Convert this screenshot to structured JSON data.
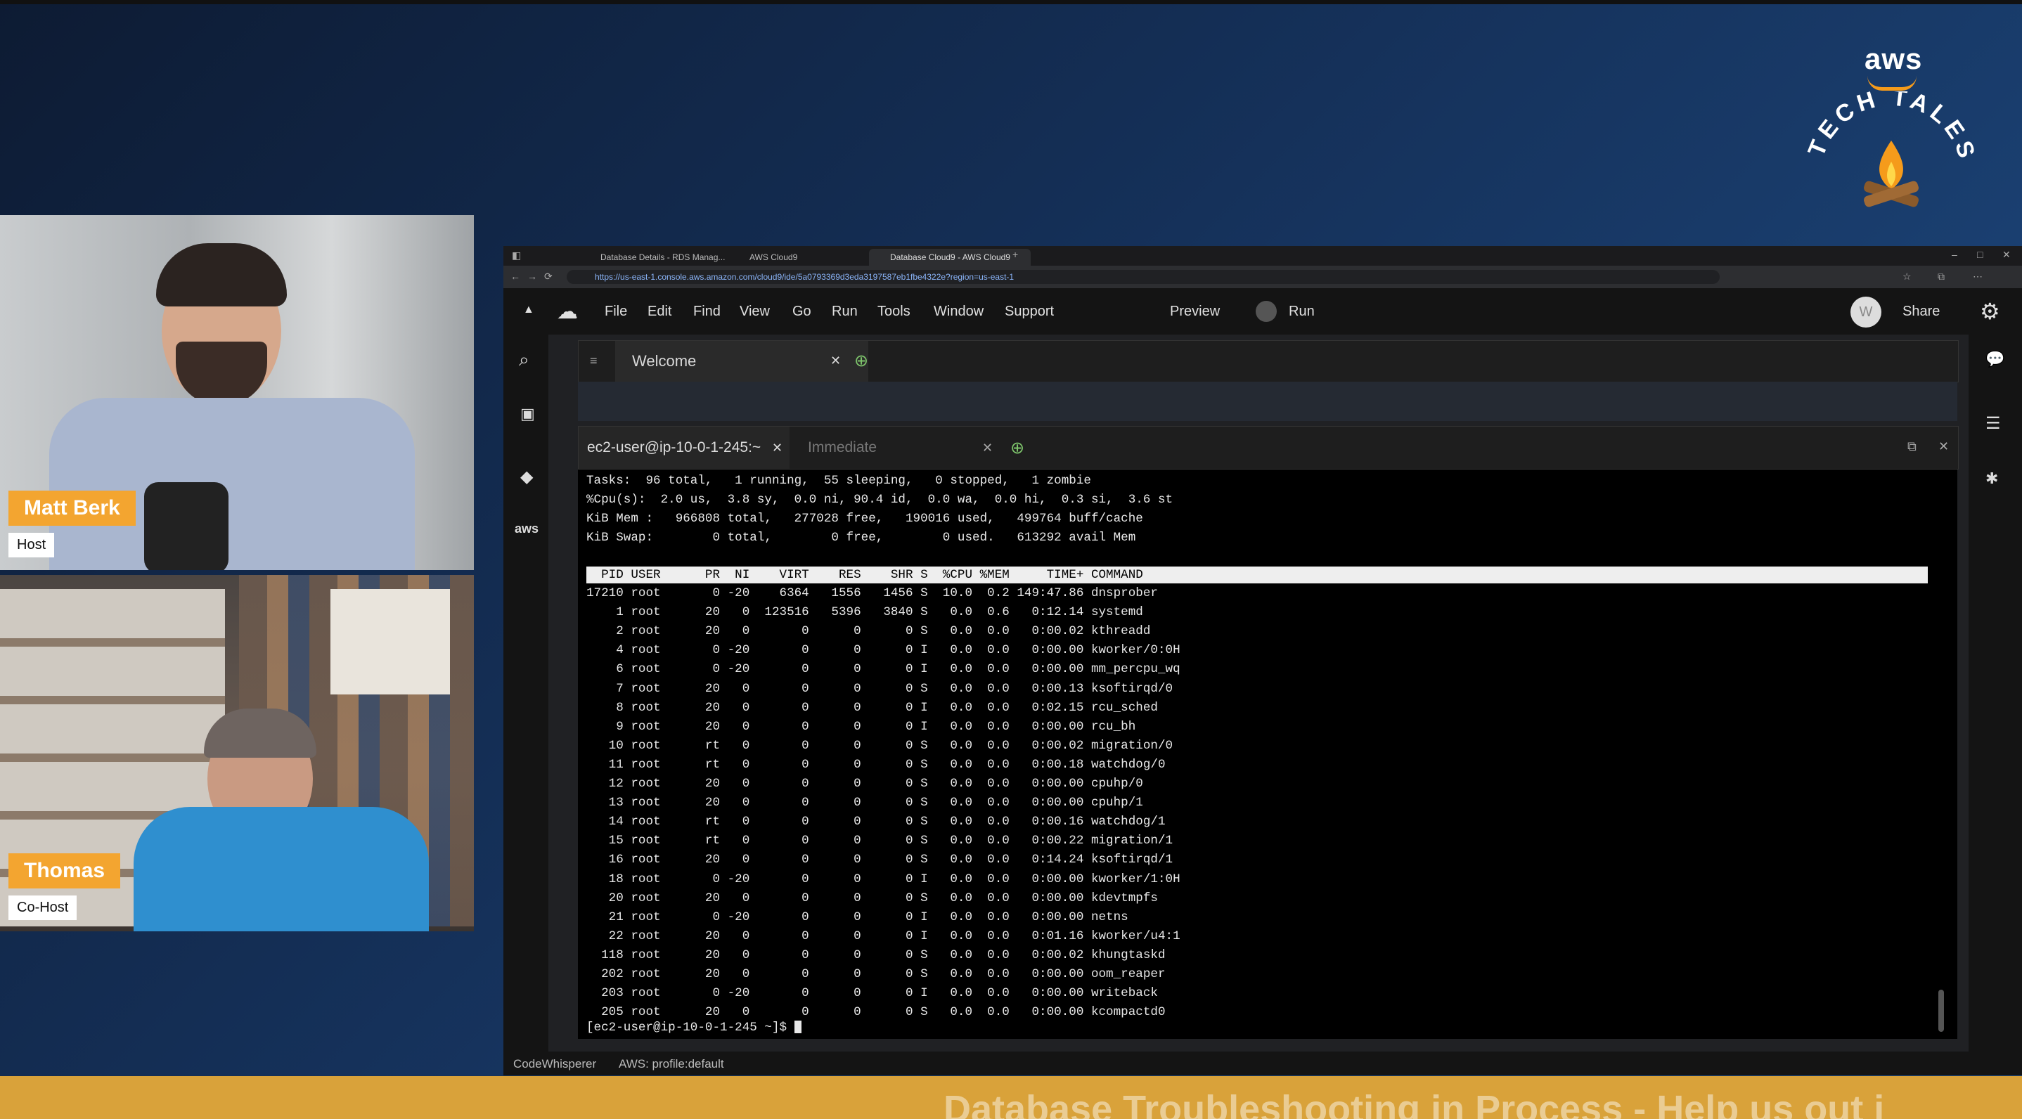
{
  "brand": {
    "aws_text": "aws",
    "show_name": "TECH TALES",
    "accent": "#f59b1b"
  },
  "participants": [
    {
      "name": "Matt Berk",
      "role": "Host"
    },
    {
      "name": "Thomas",
      "role": "Co-Host"
    }
  ],
  "browser": {
    "tabs": [
      "Database Details - RDS Manag...",
      "AWS Cloud9",
      "Database Cloud9 - AWS Cloud9"
    ],
    "url": "https://us-east-1.console.aws.amazon.com/cloud9/ide/5a0793369d3eda3197587eb1fbe4322e?region=us-east-1"
  },
  "ide": {
    "menu": [
      "File",
      "Edit",
      "Find",
      "View",
      "Go",
      "Run",
      "Tools",
      "Window",
      "Support"
    ],
    "preview": "Preview",
    "run": "Run",
    "avatar": "W",
    "share": "Share",
    "editor_tab": "Welcome",
    "terminal_tabs": [
      "ec2-user@ip-10-0-1-245:~",
      "Immediate"
    ],
    "status": {
      "left": "CodeWhisperer",
      "profile": "AWS: profile:default"
    }
  },
  "terminal": {
    "summary": [
      "Tasks:  96 total,   1 running,  55 sleeping,   0 stopped,   1 zombie",
      "%Cpu(s):  2.0 us,  3.8 sy,  0.0 ni, 90.4 id,  0.0 wa,  0.0 hi,  0.3 si,  3.6 st",
      "KiB Mem :   966808 total,   277028 free,   190016 used,   499764 buff/cache",
      "KiB Swap:        0 total,        0 free,        0 used.   613292 avail Mem"
    ],
    "header": "  PID USER      PR  NI    VIRT    RES    SHR S  %CPU %MEM     TIME+ COMMAND",
    "processes": [
      "17210 root       0 -20    6364   1556   1456 S  10.0  0.2 149:47.86 dnsprober",
      "    1 root      20   0  123516   5396   3840 S   0.0  0.6   0:12.14 systemd",
      "    2 root      20   0       0      0      0 S   0.0  0.0   0:00.02 kthreadd",
      "    4 root       0 -20       0      0      0 I   0.0  0.0   0:00.00 kworker/0:0H",
      "    6 root       0 -20       0      0      0 I   0.0  0.0   0:00.00 mm_percpu_wq",
      "    7 root      20   0       0      0      0 S   0.0  0.0   0:00.13 ksoftirqd/0",
      "    8 root      20   0       0      0      0 I   0.0  0.0   0:02.15 rcu_sched",
      "    9 root      20   0       0      0      0 I   0.0  0.0   0:00.00 rcu_bh",
      "   10 root      rt   0       0      0      0 S   0.0  0.0   0:00.02 migration/0",
      "   11 root      rt   0       0      0      0 S   0.0  0.0   0:00.18 watchdog/0",
      "   12 root      20   0       0      0      0 S   0.0  0.0   0:00.00 cpuhp/0",
      "   13 root      20   0       0      0      0 S   0.0  0.0   0:00.00 cpuhp/1",
      "   14 root      rt   0       0      0      0 S   0.0  0.0   0:00.16 watchdog/1",
      "   15 root      rt   0       0      0      0 S   0.0  0.0   0:00.22 migration/1",
      "   16 root      20   0       0      0      0 S   0.0  0.0   0:14.24 ksoftirqd/1",
      "   18 root       0 -20       0      0      0 I   0.0  0.0   0:00.00 kworker/1:0H",
      "   20 root      20   0       0      0      0 S   0.0  0.0   0:00.00 kdevtmpfs",
      "   21 root       0 -20       0      0      0 I   0.0  0.0   0:00.00 netns",
      "   22 root      20   0       0      0      0 I   0.0  0.0   0:01.16 kworker/u4:1",
      "  118 root      20   0       0      0      0 S   0.0  0.0   0:00.02 khungtaskd",
      "  202 root      20   0       0      0      0 S   0.0  0.0   0:00.00 oom_reaper",
      "  203 root       0 -20       0      0      0 I   0.0  0.0   0:00.00 writeback",
      "  205 root      20   0       0      0      0 S   0.0  0.0   0:00.00 kcompactd0"
    ],
    "prompt": "[ec2-user@ip-10-0-1-245 ~]$ "
  },
  "banner": {
    "text": "Database Troubleshooting in Process - Help us out i"
  }
}
